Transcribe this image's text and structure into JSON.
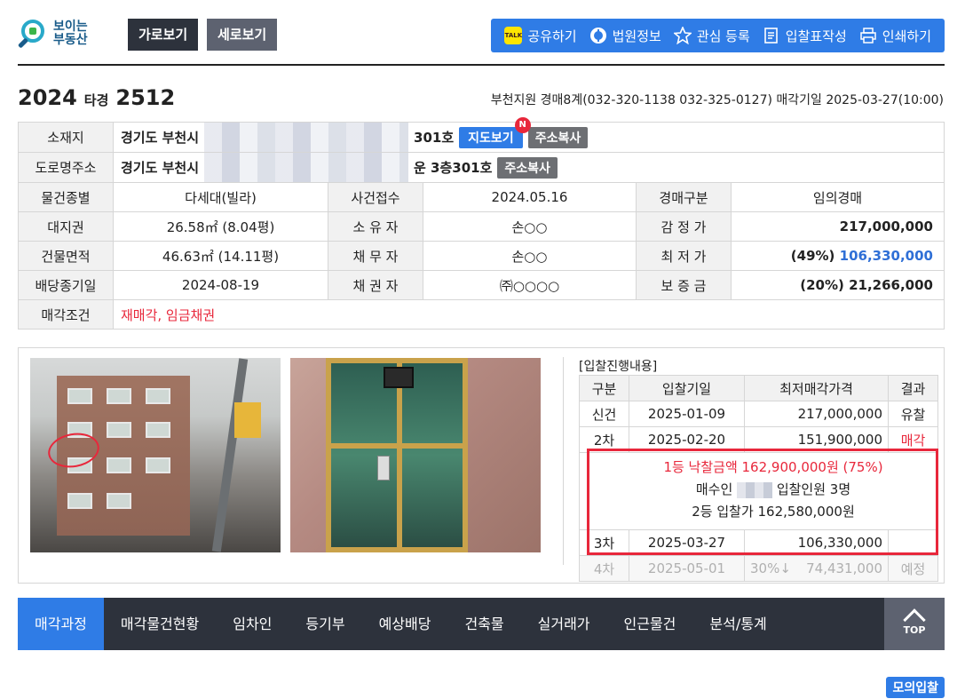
{
  "logo": {
    "line1": "보이는",
    "line2": "부동산"
  },
  "view": {
    "horizontal": "가로보기",
    "vertical": "세로보기"
  },
  "toolbar": {
    "share": "공유하기",
    "court_info": "법원정보",
    "watch": "관심 등록",
    "bid_form": "입찰표작성",
    "print": "인쇄하기",
    "kakao_text": "TALK"
  },
  "case": {
    "year": "2024",
    "kind": "타경",
    "number": "2512"
  },
  "court_line": "부천지원 경매8계(032-320-1138 032-325-0127) 매각기일 2025-03-27(10:00)",
  "info": {
    "location_label": "소재지",
    "location_prefix": "경기도 부천시",
    "location_suffix": "301호",
    "map_button": "지도보기",
    "new_badge": "N",
    "copy_button": "주소복사",
    "road_label": "도로명주소",
    "road_prefix": "경기도 부천시",
    "road_suffix": "운 3층301호",
    "road_copy_button": "주소복사",
    "rows": [
      {
        "l1": "물건종별",
        "v1": "다세대(빌라)",
        "l2": "사건접수",
        "v2": "2024.05.16",
        "l3": "경매구분",
        "v3": "임의경매"
      },
      {
        "l1": "대지권",
        "v1": "26.58㎡ (8.04평)",
        "l2": "소 유 자",
        "v2": "손○○",
        "l3": "감 정 가",
        "v3": "217,000,000"
      },
      {
        "l1": "건물면적",
        "v1": "46.63㎡ (14.11평)",
        "l2": "채 무 자",
        "v2": "손○○",
        "l3": "최 저 가",
        "v3_prefix": "(49%)",
        "v3_blue": "106,330,000"
      },
      {
        "l1": "배당종기일",
        "v1": "2024-08-19",
        "l2": "채 권 자",
        "v2": "㈜○○○○",
        "l3": "보 증 금",
        "v3": "(20%) 21,266,000"
      }
    ],
    "condition_label": "매각조건",
    "condition_value": "재매각, 임금채권"
  },
  "progress": {
    "title": "[입찰진행내용]",
    "headers": [
      "구분",
      "입찰기일",
      "최저매각가격",
      "결과"
    ],
    "rows": [
      {
        "round": "신건",
        "date": "2025-01-09",
        "price": "217,000,000",
        "result": "유찰"
      },
      {
        "round": "2차",
        "date": "2025-02-20",
        "price": "151,900,000",
        "result": "매각"
      }
    ],
    "sold_line1": "1등 낙찰금액 162,900,000원 (75%)",
    "sold_line2_a": "매수인",
    "sold_line2_b": "입찰인원 3명",
    "sold_line3": "2등 입찰가 162,580,000원",
    "row3": {
      "round": "3차",
      "date": "2025-03-27",
      "price": "106,330,000",
      "result": ""
    },
    "row4": {
      "round": "4차",
      "date": "2025-05-01",
      "pct": "30%↓",
      "price": "74,431,000",
      "result": "예정"
    }
  },
  "nav": [
    "매각과정",
    "매각물건현황",
    "임차인",
    "등기부",
    "예상배당",
    "건축물",
    "실거래가",
    "인근물건",
    "분석/통계"
  ],
  "top_button": "TOP",
  "mock_bid": "모의입찰",
  "colors": {
    "accent": "#2f7ce6",
    "dark": "#2d323c",
    "red": "#e8273b"
  }
}
